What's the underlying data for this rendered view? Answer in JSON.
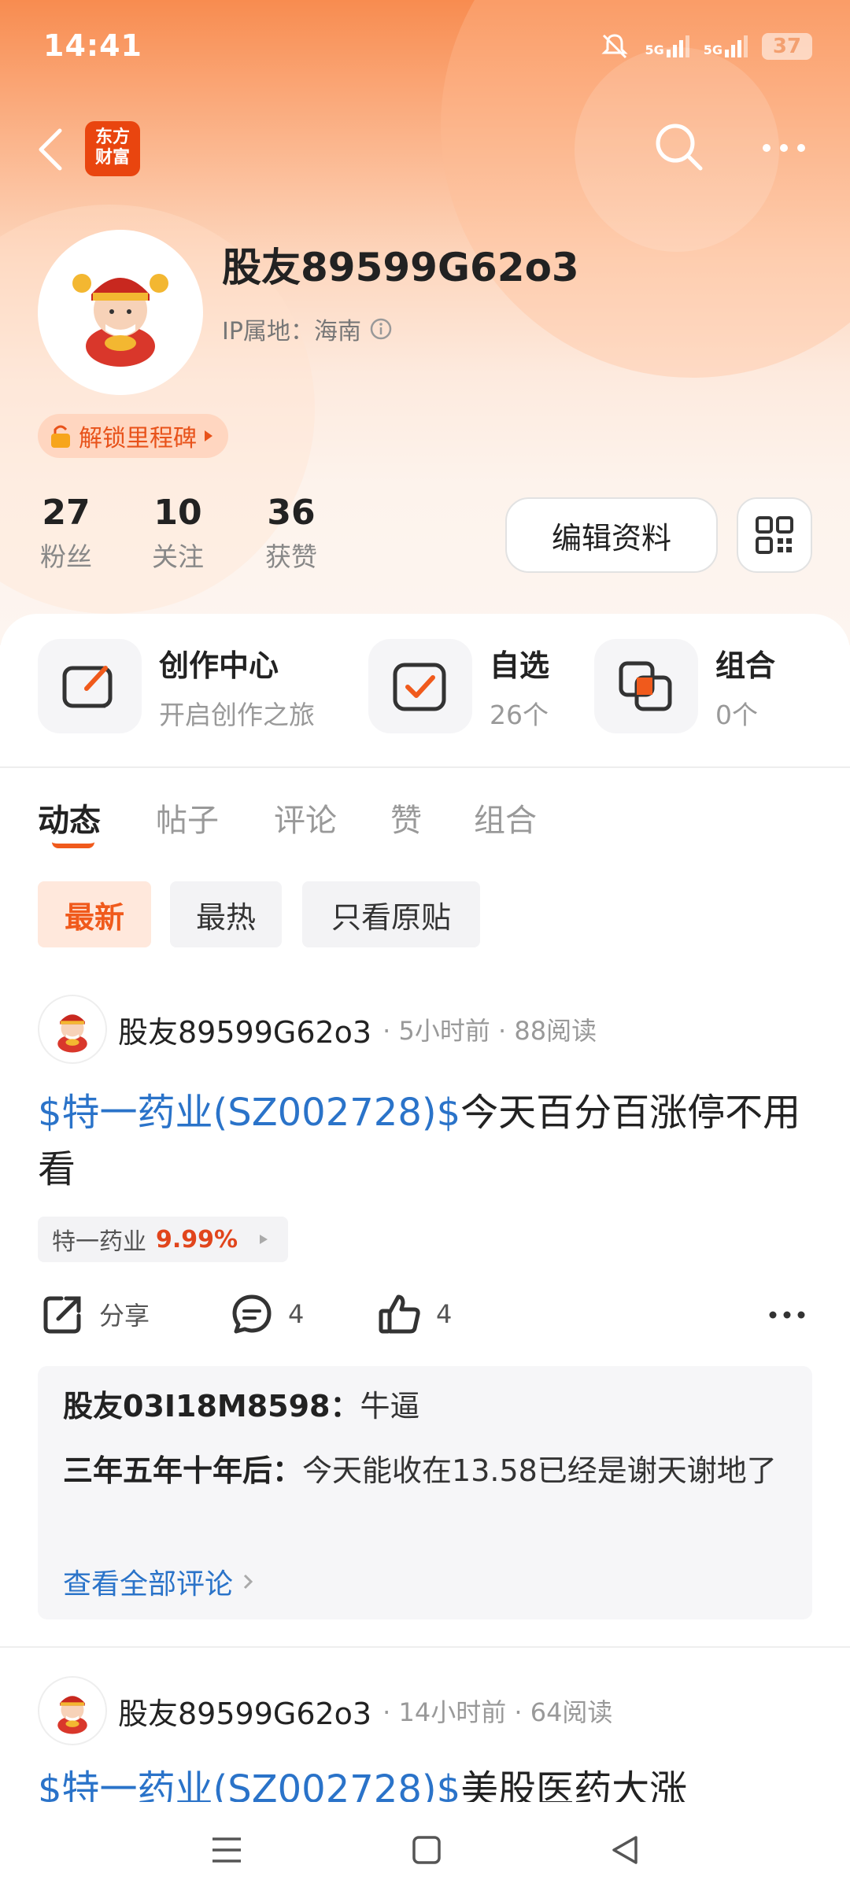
{
  "status_bar": {
    "time": "14:41",
    "signal1": "5G",
    "signal2": "5G",
    "battery": "37"
  },
  "header": {
    "logo_text_line1": "东方",
    "logo_text_line2": "财富"
  },
  "profile": {
    "username": "股友89599G62o3",
    "ip_label": "IP属地：海南",
    "milestone_label": "解锁里程碑",
    "stats": [
      {
        "value": "27",
        "label": "粉丝"
      },
      {
        "value": "10",
        "label": "关注"
      },
      {
        "value": "36",
        "label": "获赞"
      }
    ],
    "edit_button": "编辑资料"
  },
  "quick_entries": [
    {
      "title": "创作中心",
      "subtitle": "开启创作之旅"
    },
    {
      "title": "自选",
      "subtitle": "26个"
    },
    {
      "title": "组合",
      "subtitle": "0个"
    }
  ],
  "tabs": [
    "动态",
    "帖子",
    "评论",
    "赞",
    "组合"
  ],
  "filters": [
    "最新",
    "最热",
    "只看原贴"
  ],
  "posts": [
    {
      "user": "股友89599G62o3",
      "meta": "· 5小时前 · 88阅读",
      "link_text": "$特一药业(SZ002728)$",
      "text": "今天百分百涨停不用看",
      "stock_name": "特一药业",
      "stock_change": "9.99%",
      "share_label": "分享",
      "comment_count": "4",
      "like_count": "4",
      "comments": [
        {
          "user": "股友03I18M8598：",
          "text": "牛逼"
        },
        {
          "user": "三年五年十年后：",
          "text": "今天能收在13.58已经是谢天谢地了"
        }
      ],
      "view_all_comments": "查看全部评论"
    },
    {
      "user": "股友89599G62o3",
      "meta": "· 14小时前 · 64阅读",
      "link_text": "$特一药业(SZ002728)$",
      "text": "美股医药大涨"
    }
  ],
  "colors": {
    "accent": "#f05a1c",
    "link": "#2a73c9",
    "brand": "#e9450f"
  }
}
